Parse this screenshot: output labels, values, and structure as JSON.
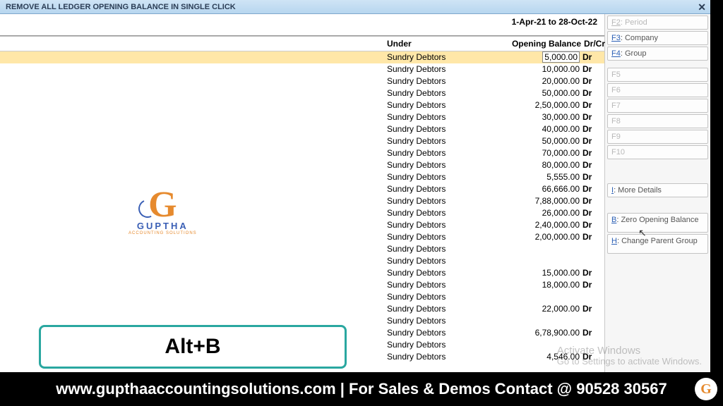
{
  "title": "REMOVE ALL LEDGER OPENING BALANCE IN SINGLE CLICK",
  "close": "✕",
  "period": "1-Apr-21 to 28-Oct-22",
  "columns": {
    "under": "Under",
    "balance": "Opening Balance",
    "drcr": "Dr/Cr"
  },
  "rows": [
    {
      "under": "Sundry Debtors",
      "bal": "5,000.00",
      "drcr": "Dr",
      "sel": true
    },
    {
      "under": "Sundry Debtors",
      "bal": "10,000.00",
      "drcr": "Dr"
    },
    {
      "under": "Sundry Debtors",
      "bal": "20,000.00",
      "drcr": "Dr"
    },
    {
      "under": "Sundry Debtors",
      "bal": "50,000.00",
      "drcr": "Dr"
    },
    {
      "under": "Sundry Debtors",
      "bal": "2,50,000.00",
      "drcr": "Dr"
    },
    {
      "under": "Sundry Debtors",
      "bal": "30,000.00",
      "drcr": "Dr"
    },
    {
      "under": "Sundry Debtors",
      "bal": "40,000.00",
      "drcr": "Dr"
    },
    {
      "under": "Sundry Debtors",
      "bal": "50,000.00",
      "drcr": "Dr"
    },
    {
      "under": "Sundry Debtors",
      "bal": "70,000.00",
      "drcr": "Dr"
    },
    {
      "under": "Sundry Debtors",
      "bal": "80,000.00",
      "drcr": "Dr"
    },
    {
      "under": "Sundry Debtors",
      "bal": "5,555.00",
      "drcr": "Dr"
    },
    {
      "under": "Sundry Debtors",
      "bal": "66,666.00",
      "drcr": "Dr"
    },
    {
      "under": "Sundry Debtors",
      "bal": "7,88,000.00",
      "drcr": "Dr"
    },
    {
      "under": "Sundry Debtors",
      "bal": "26,000.00",
      "drcr": "Dr"
    },
    {
      "under": "Sundry Debtors",
      "bal": "2,40,000.00",
      "drcr": "Dr"
    },
    {
      "under": "Sundry Debtors",
      "bal": "2,00,000.00",
      "drcr": "Dr"
    },
    {
      "under": "Sundry Debtors",
      "bal": "",
      "drcr": ""
    },
    {
      "under": "Sundry Debtors",
      "bal": "",
      "drcr": ""
    },
    {
      "under": "Sundry Debtors",
      "bal": "15,000.00",
      "drcr": "Dr"
    },
    {
      "under": "Sundry Debtors",
      "bal": "18,000.00",
      "drcr": "Dr"
    },
    {
      "under": "Sundry Debtors",
      "bal": "",
      "drcr": ""
    },
    {
      "under": "Sundry Debtors",
      "bal": "22,000.00",
      "drcr": "Dr"
    },
    {
      "under": "Sundry Debtors",
      "bal": "",
      "drcr": ""
    },
    {
      "under": "Sundry Debtors",
      "bal": "6,78,900.00",
      "drcr": "Dr"
    },
    {
      "under": "Sundry Debtors",
      "bal": "",
      "drcr": ""
    },
    {
      "under": "Sundry Debtors",
      "bal": "4,546.00",
      "drcr": "Dr"
    }
  ],
  "side": {
    "f2": "Period",
    "f3": "Company",
    "f4": "Group",
    "f5": "F5",
    "f6": "F6",
    "f7": "F7",
    "f8": "F8",
    "f9": "F9",
    "f10": "F10",
    "more_k": "I",
    "more": ": More Details",
    "zero_k": "B",
    "zero": ": Zero Opening Balance",
    "chg_k": "H",
    "chg": ": Change Parent Group"
  },
  "logo": {
    "brand": "GUPTHA",
    "sub": "ACCOUNTING SOLUTIONS"
  },
  "hint": "Alt+B",
  "footer": "www.gupthaaccountingsolutions.com | For Sales & Demos Contact @ 90528 30567",
  "watermark": {
    "l1": "Activate Windows",
    "l2": "Go to Settings to activate Windows."
  }
}
